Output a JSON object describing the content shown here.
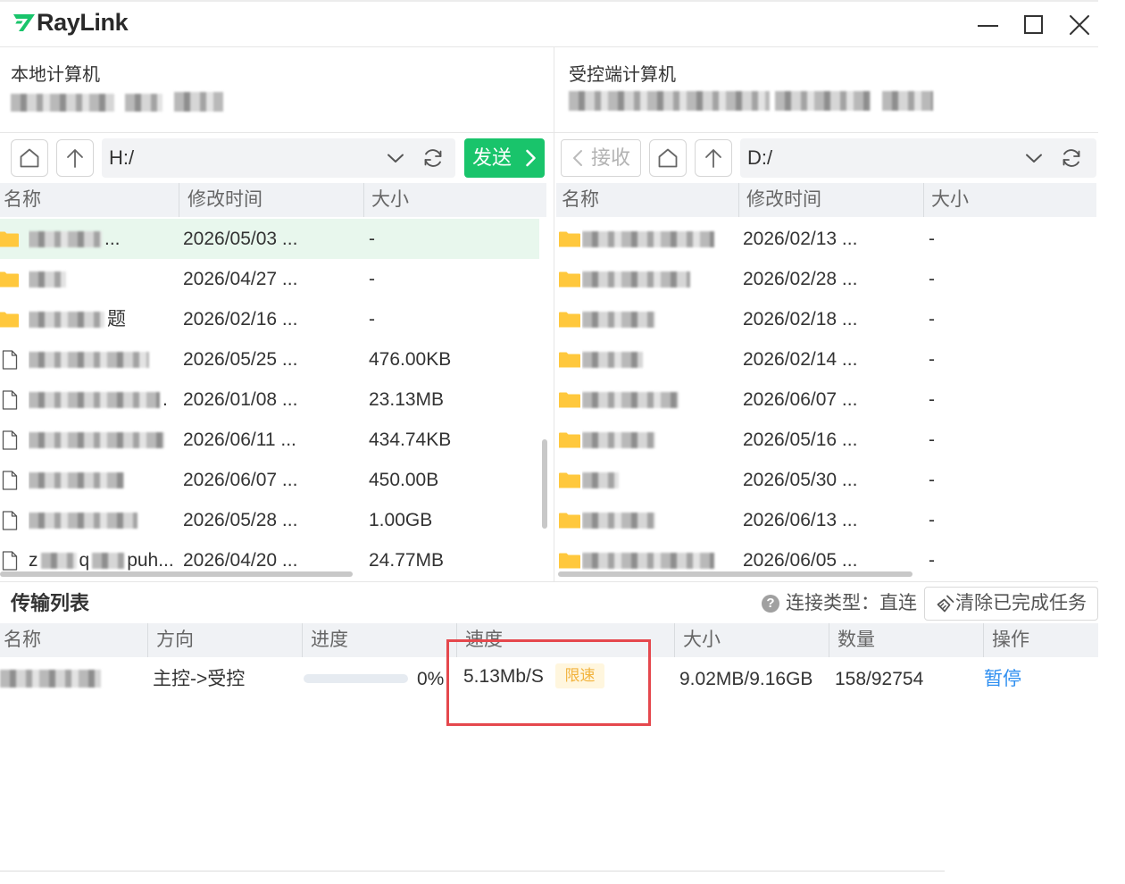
{
  "app": {
    "title": "RayLink"
  },
  "colors": {
    "green": "#19c46b",
    "sel": "#e8f7ed",
    "hdr": "#f0f2f5",
    "blue": "#2f8ff0",
    "folder": "#ffc83d",
    "badge-bg": "#fff6de",
    "badge-fg": "#f2b33d",
    "red": "#e5484d"
  },
  "icons": {
    "logo": "raylink-logo-icon",
    "minimize": "minimize-icon",
    "maximize": "maximize-icon",
    "close": "close-icon",
    "home": "home-icon",
    "up": "arrow-up-icon",
    "dropdown": "chevron-down-icon",
    "refresh": "refresh-icon",
    "send": "chevron-right-icon",
    "receive": "chevron-left-icon",
    "help": "question-circle-icon",
    "clear": "broom-icon"
  },
  "local": {
    "heading": "本地计算机",
    "path": "H:/",
    "send_label": "发送",
    "columns": {
      "name": "名称",
      "modified": "修改时间",
      "size": "大小"
    },
    "rows": [
      {
        "icon": "folder-icon",
        "name_end": "...",
        "modified": "2026/05/03 ...",
        "size": "-",
        "selected": true
      },
      {
        "icon": "folder-icon",
        "modified": "2026/04/27 ...",
        "size": "-"
      },
      {
        "icon": "folder-icon",
        "name_end": "题",
        "modified": "2026/02/16 ...",
        "size": "-"
      },
      {
        "icon": "file-icon",
        "modified": "2026/05/25 ...",
        "size": "476.00KB"
      },
      {
        "icon": "file-icon",
        "name_end": ".",
        "modified": "2026/01/08 ...",
        "size": "23.13MB"
      },
      {
        "icon": "file-icon",
        "modified": "2026/06/11 ...",
        "size": "434.74KB"
      },
      {
        "icon": "file-icon",
        "modified": "2026/06/07 ...",
        "size": "450.00B"
      },
      {
        "icon": "file-icon",
        "modified": "2026/05/28 ...",
        "size": "1.00GB"
      },
      {
        "icon": "file-icon",
        "name_start": "z",
        "name_mid": "q",
        "name_end": "puh...",
        "modified": "2026/04/20 ...",
        "size": "24.77MB"
      }
    ]
  },
  "remote": {
    "heading": "受控端计算机",
    "path": "D:/",
    "receive_label": "接收",
    "columns": {
      "name": "名称",
      "modified": "修改时间",
      "size": "大小"
    },
    "rows": [
      {
        "icon": "folder-icon",
        "modified": "2026/02/13 ...",
        "size": "-"
      },
      {
        "icon": "folder-icon",
        "modified": "2026/02/28 ...",
        "size": "-"
      },
      {
        "icon": "folder-icon",
        "modified": "2026/02/18 ...",
        "size": "-"
      },
      {
        "icon": "folder-icon",
        "modified": "2026/02/14 ...",
        "size": "-"
      },
      {
        "icon": "folder-icon",
        "modified": "2026/06/07 ...",
        "size": "-"
      },
      {
        "icon": "folder-icon",
        "modified": "2026/05/16 ...",
        "size": "-"
      },
      {
        "icon": "folder-icon",
        "modified": "2026/05/30 ...",
        "size": "-"
      },
      {
        "icon": "folder-icon",
        "modified": "2026/06/13 ...",
        "size": "-"
      },
      {
        "icon": "folder-icon",
        "modified": "2026/06/05 ...",
        "size": "-"
      }
    ]
  },
  "transfer": {
    "title": "传输列表",
    "connection": "连接类型：直连",
    "clear_label": "清除已完成任务",
    "columns": {
      "name": "名称",
      "direction": "方向",
      "progress": "进度",
      "speed": "速度",
      "size": "大小",
      "count": "数量",
      "action": "操作"
    },
    "rows": [
      {
        "direction": "主控->受控",
        "progress": 0,
        "progress_text": "0%",
        "speed": "5.13Mb/S",
        "speed_limit_badge": "限速",
        "size": "9.02MB/9.16GB",
        "count": "158/92754",
        "action": "暂停"
      }
    ]
  }
}
